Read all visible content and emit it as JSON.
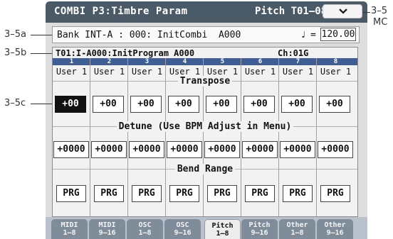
{
  "header": {
    "title": "COMBI P3:Timbre Param",
    "page_indicator": "Pitch T01–08",
    "menu_icon": "chevron-down-icon"
  },
  "callouts": {
    "top_right_line1": "3–5",
    "top_right_line2": "MC",
    "a": "3–5a",
    "b": "3–5b",
    "c": "3–5c"
  },
  "bank": {
    "text": "Bank INT-A : 000: InitCombi  A000",
    "tempo_icon": "♩",
    "tempo_eq": "=",
    "tempo_value": "120.00"
  },
  "timbre": {
    "program": "T01:I-A000:InitProgram A000",
    "channel": "Ch:01G"
  },
  "columns": [
    {
      "num": "1",
      "user": "User 1",
      "transpose": "+00",
      "detune": "+0000",
      "bend": "PRG",
      "selected": true
    },
    {
      "num": "2",
      "user": "User 1",
      "transpose": "+00",
      "detune": "+0000",
      "bend": "PRG",
      "selected": false
    },
    {
      "num": "3",
      "user": "User 1",
      "transpose": "+00",
      "detune": "+0000",
      "bend": "PRG",
      "selected": false
    },
    {
      "num": "4",
      "user": "User 1",
      "transpose": "+00",
      "detune": "+0000",
      "bend": "PRG",
      "selected": false
    },
    {
      "num": "5",
      "user": "User 1",
      "transpose": "+00",
      "detune": "+0000",
      "bend": "PRG",
      "selected": false
    },
    {
      "num": "6",
      "user": "User 1",
      "transpose": "+00",
      "detune": "+0000",
      "bend": "PRG",
      "selected": false
    },
    {
      "num": "7",
      "user": "User 1",
      "transpose": "+00",
      "detune": "+0000",
      "bend": "PRG",
      "selected": false
    },
    {
      "num": "8",
      "user": "User 1",
      "transpose": "+00",
      "detune": "+0000",
      "bend": "PRG",
      "selected": false
    }
  ],
  "sections": {
    "transpose": "Transpose",
    "detune": "Detune (Use BPM Adjust in Menu)",
    "bend": "Bend Range"
  },
  "tabs": [
    {
      "line1": "MIDI",
      "line2": "1–8",
      "active": false
    },
    {
      "line1": "MIDI",
      "line2": "9–16",
      "active": false
    },
    {
      "line1": "OSC",
      "line2": "1–8",
      "active": false
    },
    {
      "line1": "OSC",
      "line2": "9–16",
      "active": false
    },
    {
      "line1": "Pitch",
      "line2": "1–8",
      "active": true
    },
    {
      "line1": "Pitch",
      "line2": "9–16",
      "active": false
    },
    {
      "line1": "Other",
      "line2": "1–8",
      "active": false
    },
    {
      "line1": "Other",
      "line2": "9–16",
      "active": false
    }
  ]
}
